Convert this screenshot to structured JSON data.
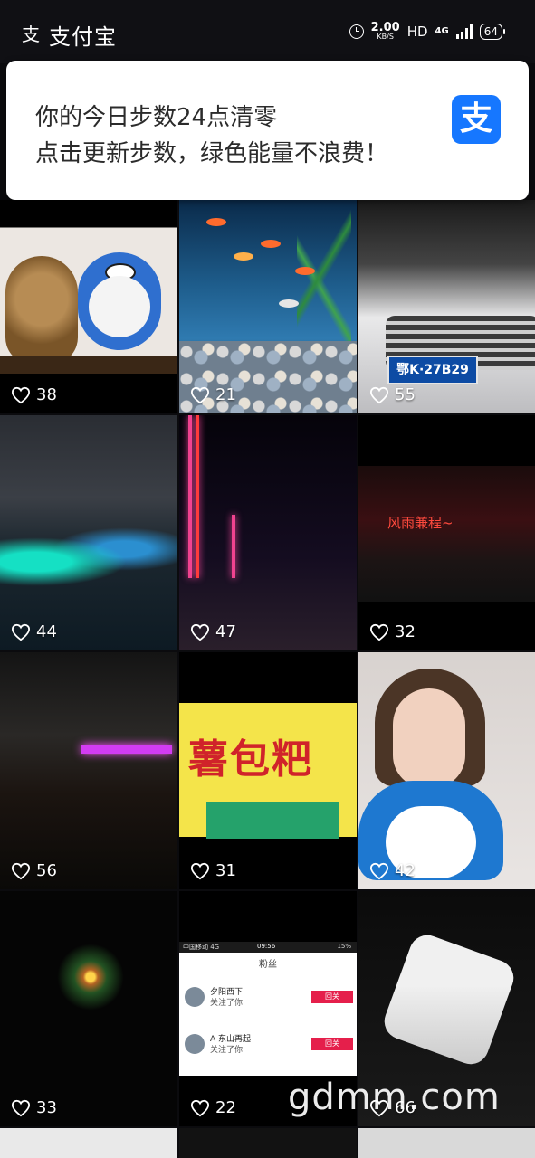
{
  "status_bar": {
    "app_name": "支付宝",
    "speed_value": "2.00",
    "speed_unit": "KB/S",
    "hd": "HD",
    "network": "4G",
    "battery": "64"
  },
  "notification": {
    "line1": "你的今日步数24点清零",
    "line2": "点击更新步数，绿色能量不浪费！",
    "app_logo": "支"
  },
  "tiles": [
    {
      "likes": "38"
    },
    {
      "likes": "21"
    },
    {
      "likes": "55",
      "plate_text": "鄂K·27B29"
    },
    {
      "likes": "44"
    },
    {
      "likes": "47"
    },
    {
      "likes": "32",
      "overlay_text": "风雨兼程~"
    },
    {
      "likes": "56"
    },
    {
      "likes": "31",
      "sign_text": "薯包粑"
    },
    {
      "likes": "42"
    },
    {
      "likes": "33"
    },
    {
      "likes": "22",
      "screenshot": {
        "carrier": "中国移动 4G",
        "time": "09:56",
        "battery": "15%",
        "title": "粉丝",
        "rows": [
          {
            "name": "夕阳西下",
            "sub": "关注了你",
            "button": "回关"
          },
          {
            "name": "A 东山再起",
            "sub": "关注了你",
            "button": "回关"
          }
        ]
      }
    },
    {
      "likes": "66"
    }
  ],
  "icons": {
    "like": "heart-outline-icon",
    "app": "alipay-logo-icon",
    "alarm": "alarm-clock-icon",
    "signal": "signal-bars-icon",
    "battery": "battery-icon"
  },
  "watermark": "gdmm.com",
  "colors": {
    "background": "#0b0b0e",
    "notification_bg": "#ffffff",
    "alipay_blue": "#1677ff",
    "text_dark": "#2b2b2b"
  }
}
